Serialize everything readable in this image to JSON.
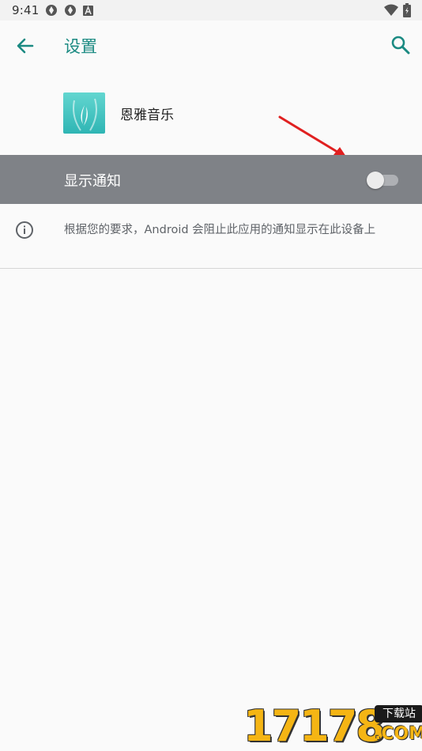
{
  "status_bar": {
    "time": "9:41",
    "icons": [
      "sync-icon",
      "sync-icon",
      "a-badge-icon"
    ],
    "right_icons": [
      "wifi-icon",
      "battery-icon"
    ]
  },
  "app_bar": {
    "title": "设置",
    "back_icon": "arrow-back-icon",
    "search_icon": "search-icon",
    "accent_color": "#1b8a82"
  },
  "app": {
    "name": "恩雅音乐",
    "icon": "app-logo-icon"
  },
  "notification_setting": {
    "label": "显示通知",
    "enabled": false,
    "row_color": "#7f8287"
  },
  "info": {
    "icon": "info-icon",
    "text": "根据您的要求，Android 会阻止此应用的通知显示在此设备上"
  },
  "annotation": {
    "arrow_color": "#e02020"
  },
  "watermark": {
    "number": "17178",
    "badge": "下载站",
    "domain": ".COM"
  }
}
